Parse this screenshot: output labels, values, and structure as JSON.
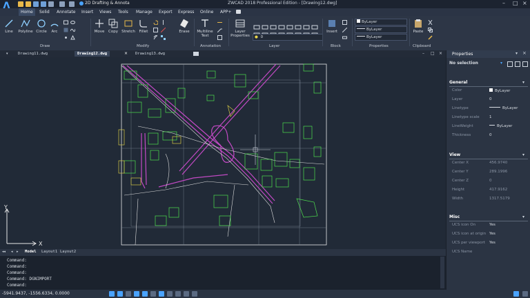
{
  "app": {
    "workspace": "2D Drafting & Annota",
    "title": "ZWCAD 2018 Professional Edition - [Drawing12.dwg]"
  },
  "menu": {
    "tabs": [
      "Home",
      "Solid",
      "Annotate",
      "Insert",
      "Views",
      "Tools",
      "Manage",
      "Export",
      "Express",
      "Online",
      "APP+"
    ]
  },
  "ribbon": {
    "draw": {
      "line": "Line",
      "polyline": "Polyline",
      "circle": "Circle",
      "arc": "Arc",
      "label": "Draw"
    },
    "modify": {
      "move": "Move",
      "copy": "Copy",
      "stretch": "Stretch",
      "fillet": "Fillet",
      "erase": "Erase",
      "label": "Modify"
    },
    "annotation": {
      "multiline": "Multiline",
      "text": "Text",
      "label": "Annotation"
    },
    "layer": {
      "properties": "Layer",
      "properties2": "Properties",
      "label": "Layer",
      "current": "0"
    },
    "block": {
      "insert": "Insert",
      "label": "Block"
    },
    "properties": {
      "color": "ByLayer",
      "linetype": "ByLayer",
      "lineweight": "ByLayer",
      "label": "Properties"
    },
    "clipboard": {
      "paste": "Paste",
      "label": "Clipboard"
    }
  },
  "doctabs": [
    "Drawing11.dwg",
    "Drawing12.dwg",
    "Drawing13.dwg"
  ],
  "layouttabs": [
    "Model",
    "Layout1",
    "Layout2"
  ],
  "command": {
    "history": [
      "Command:",
      "Command:",
      "Command:",
      "Command: DGNIMPORT"
    ],
    "prompt": "Command:"
  },
  "status": {
    "coords": "-5941.9437, -1556.6334, 0.0000"
  },
  "axes": {
    "x": "X",
    "y": "Y"
  },
  "properties": {
    "title": "Properties",
    "selection": "No selection",
    "general": {
      "label": "General",
      "rows": [
        {
          "k": "Color",
          "v": "ByLayer"
        },
        {
          "k": "Layer",
          "v": "0"
        },
        {
          "k": "Linetype",
          "v": "ByLayer"
        },
        {
          "k": "Linetype scale",
          "v": "1"
        },
        {
          "k": "LineWeight",
          "v": "ByLayer"
        },
        {
          "k": "Thickness",
          "v": "0"
        }
      ]
    },
    "view": {
      "label": "View",
      "rows": [
        {
          "k": "Center X",
          "v": "456.9740"
        },
        {
          "k": "Center Y",
          "v": "289.1996"
        },
        {
          "k": "Center Z",
          "v": "0"
        },
        {
          "k": "Height",
          "v": "417.9162"
        },
        {
          "k": "Width",
          "v": "1317.5179"
        }
      ]
    },
    "misc": {
      "label": "Misc",
      "rows": [
        {
          "k": "UCS icon On",
          "v": "Yes"
        },
        {
          "k": "UCS icon at origin",
          "v": "Yes"
        },
        {
          "k": "UCS per viewport",
          "v": "Yes"
        },
        {
          "k": "UCS Name",
          "v": ""
        }
      ]
    }
  },
  "colors": {
    "accent": "#4aa3ff",
    "background": "#212a37",
    "green": "#4ee04e",
    "magenta": "#d04ad0",
    "white": "#e8e8e8"
  }
}
